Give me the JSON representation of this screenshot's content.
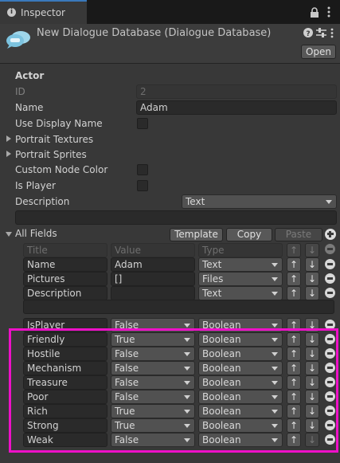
{
  "tab": {
    "title": "Inspector"
  },
  "header": {
    "title": "New Dialogue Database (Dialogue Database)",
    "open_label": "Open"
  },
  "actor": {
    "section_label": "Actor",
    "id_label": "ID",
    "id_value": "2",
    "name_label": "Name",
    "name_value": "Adam",
    "use_display_name_label": "Use Display Name",
    "portrait_textures_label": "Portrait Textures",
    "portrait_sprites_label": "Portrait Sprites",
    "custom_node_color_label": "Custom Node Color",
    "is_player_label": "Is Player",
    "description_label": "Description",
    "description_type": "Text"
  },
  "all_fields": {
    "label": "All Fields",
    "template_label": "Template",
    "copy_label": "Copy",
    "paste_label": "Paste",
    "columns": {
      "title": "Title",
      "value": "Value",
      "type": "Type"
    },
    "rows": [
      {
        "title": "Name",
        "value": "Adam",
        "type": "Text"
      },
      {
        "title": "Pictures",
        "value": "[]",
        "type": "Files"
      },
      {
        "title": "Description",
        "value": "",
        "type": "Text"
      },
      {
        "title": "IsPlayer",
        "value": "False",
        "type": "Boolean"
      },
      {
        "title": "Friendly",
        "value": "True",
        "type": "Boolean"
      },
      {
        "title": "Hostile",
        "value": "False",
        "type": "Boolean"
      },
      {
        "title": "Mechanism",
        "value": "False",
        "type": "Boolean"
      },
      {
        "title": "Treasure",
        "value": "False",
        "type": "Boolean"
      },
      {
        "title": "Poor",
        "value": "False",
        "type": "Boolean"
      },
      {
        "title": "Rich",
        "value": "True",
        "type": "Boolean"
      },
      {
        "title": "Strong",
        "value": "True",
        "type": "Boolean"
      },
      {
        "title": "Weak",
        "value": "False",
        "type": "Boolean"
      }
    ]
  },
  "glyphs": {
    "up": "↑",
    "down": "↓",
    "help": "?",
    "settings": "⇄",
    "more": "⋮",
    "lock": "🔒"
  },
  "colors": {
    "highlight": "#ee10c8",
    "accent": "#3a79bb"
  }
}
